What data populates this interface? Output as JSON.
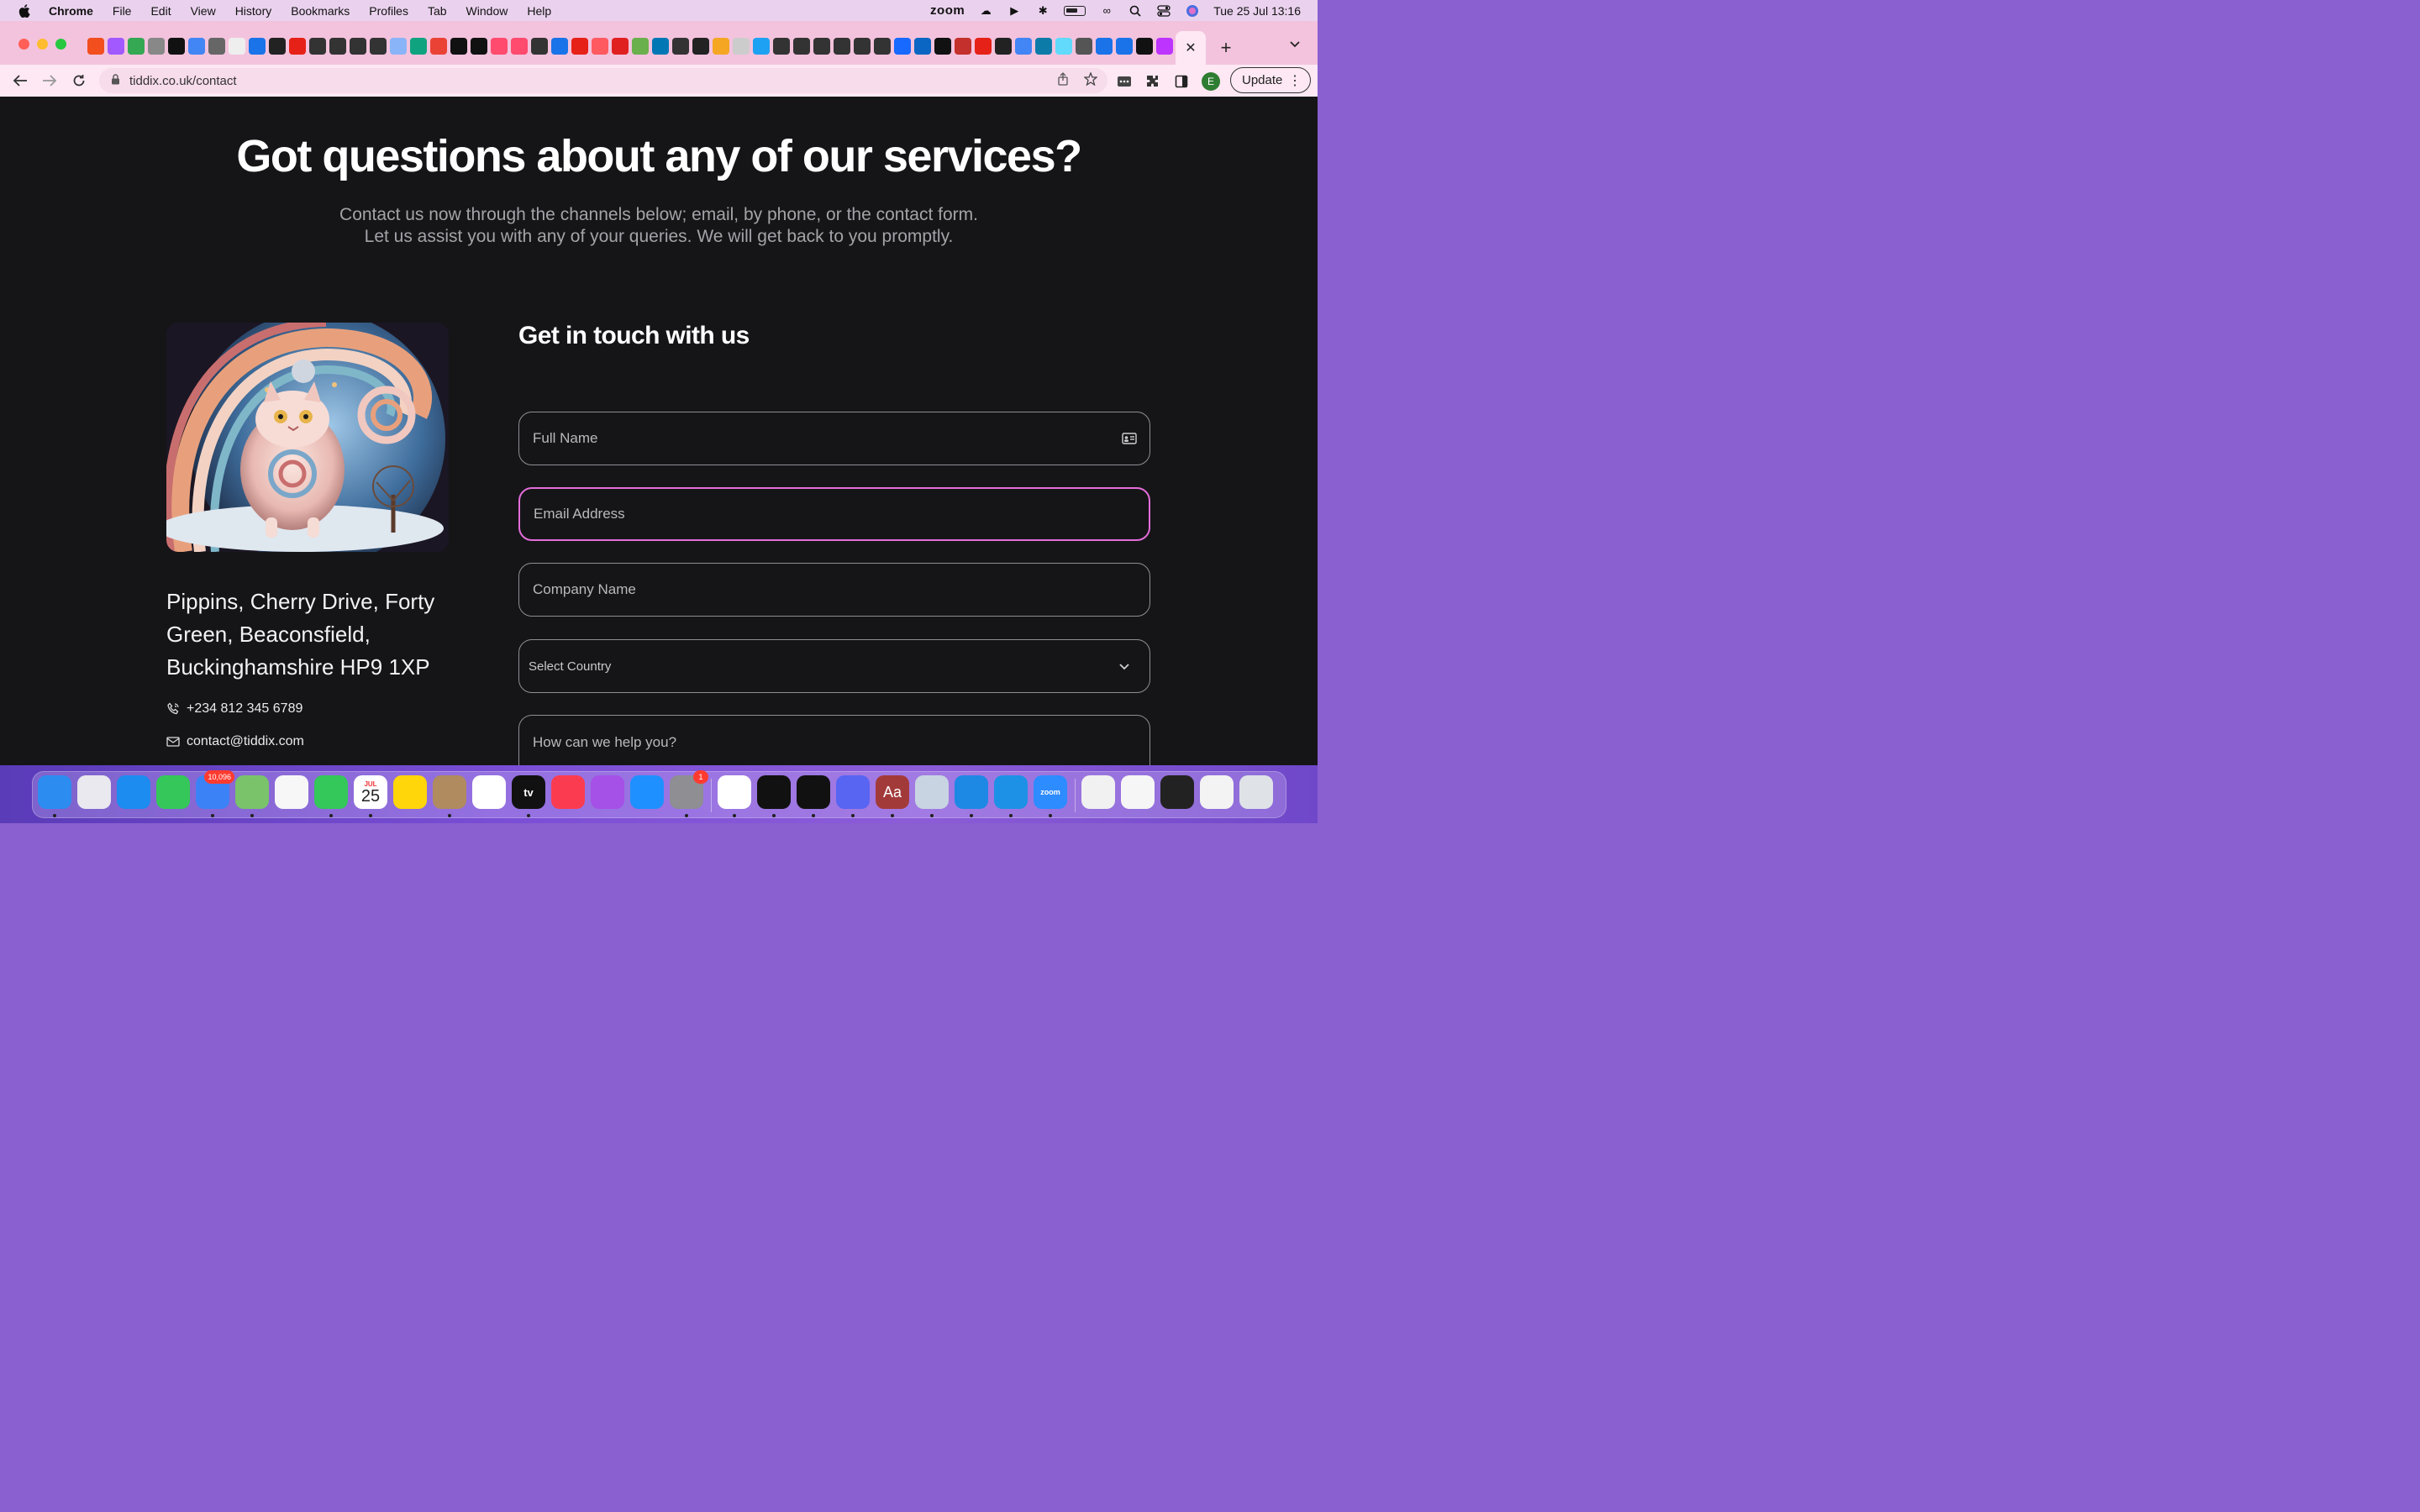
{
  "menubar": {
    "app_name": "Chrome",
    "items": [
      "File",
      "Edit",
      "View",
      "History",
      "Bookmarks",
      "Profiles",
      "Tab",
      "Window",
      "Help"
    ],
    "zoom_label": "zoom",
    "datetime": "Tue 25 Jul  13:16"
  },
  "browser": {
    "url": "tiddix.co.uk/contact",
    "update_label": "Update",
    "profile_initial": "E",
    "active_tab_close": "✕",
    "new_tab": "+"
  },
  "page": {
    "hero_title": "Got questions about any of our services?",
    "hero_sub_line1": "Contact us now through the channels below; email, by phone, or the contact form.",
    "hero_sub_line2": "Let us assist you with any of your queries. We will get back to you promptly.",
    "address": "Pippins, Cherry Drive, Forty Green, Beaconsfield, Buckinghamshire HP9 1XP",
    "phone": "+234 812 345 6789",
    "email": "contact@tiddix.com"
  },
  "form": {
    "title": "Get in touch with us",
    "full_name_placeholder": "Full Name",
    "email_placeholder": "Email Address",
    "company_placeholder": "Company Name",
    "country_placeholder": "Select Country",
    "message_placeholder": "How can we help you?"
  },
  "dock": {
    "mail_badge": "10,096",
    "calendar_month": "JUL",
    "calendar_day": "25",
    "settings_badge": "1",
    "tv_label": "tv",
    "dictionary_label": "Aa",
    "zoom_label": "zoom"
  },
  "colors": {
    "focus_border": "#e46dd9",
    "page_bg": "#151518",
    "tabstrip_bg": "#f3c3dd"
  }
}
